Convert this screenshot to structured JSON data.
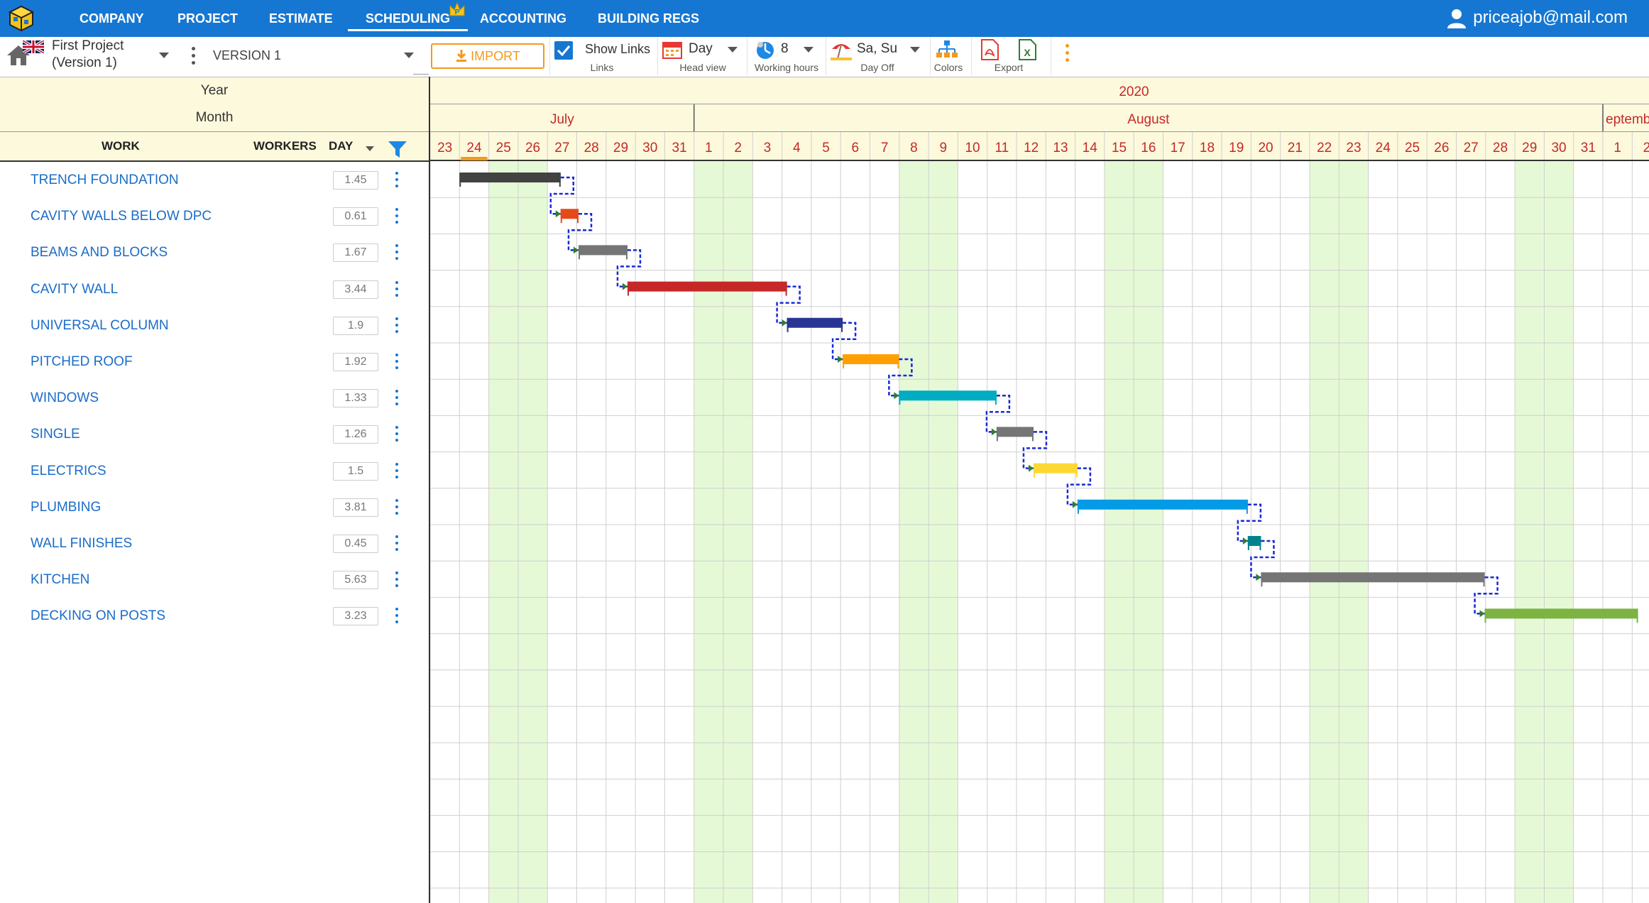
{
  "nav": {
    "items": [
      "COMPANY",
      "PROJECT",
      "ESTIMATE",
      "SCHEDULING",
      "ACCOUNTING",
      "BUILDING REGS"
    ],
    "active": "SCHEDULING",
    "crown_badge": "P",
    "user_email": "priceajob@mail.com"
  },
  "toolbar": {
    "project_name": "First Project",
    "project_version": "(Version 1)",
    "version_select": "VERSION 1",
    "import_label": "IMPORT",
    "show_links_label": "Show Links",
    "show_links_checked": true,
    "links_caption": "Links",
    "head_view_value": "Day",
    "head_view_caption": "Head view",
    "working_hours_value": "8",
    "working_hours_caption": "Working hours",
    "day_off_value": "Sa, Su",
    "day_off_caption": "Day Off",
    "colors_caption": "Colors",
    "export_caption": "Export"
  },
  "grid_header": {
    "year_label": "Year",
    "month_label": "Month",
    "work_col": "WORK",
    "workers_col": "WORKERS",
    "day_col": "DAY",
    "year_value": "2020",
    "months": [
      {
        "label": "July",
        "first_day": "23",
        "last_day": "31"
      },
      {
        "label": "August",
        "first_day": "1",
        "last_day": "31"
      },
      {
        "label": "eptemb",
        "first_day": "1",
        "last_day": "2"
      }
    ],
    "days": [
      "23",
      "24",
      "25",
      "26",
      "27",
      "28",
      "29",
      "30",
      "31",
      "1",
      "2",
      "3",
      "4",
      "5",
      "6",
      "7",
      "8",
      "9",
      "10",
      "11",
      "12",
      "13",
      "14",
      "15",
      "16",
      "17",
      "18",
      "19",
      "20",
      "21",
      "22",
      "23",
      "24",
      "25",
      "26",
      "27",
      "28",
      "29",
      "30",
      "31",
      "1",
      "2"
    ],
    "weekend_day_indices": [
      2,
      3,
      9,
      10,
      16,
      17,
      23,
      24,
      30,
      31,
      37,
      38
    ],
    "today_marker_day_index": 1
  },
  "tasks": [
    {
      "name": "TRENCH FOUNDATION",
      "days": "1.45",
      "color": "#424242",
      "start_day_index": 1.0,
      "duration_days": 3.45
    },
    {
      "name": "CAVITY WALLS BELOW DPC",
      "days": "0.61",
      "color": "#e64a19",
      "start_day_index": 4.45,
      "duration_days": 0.61
    },
    {
      "name": "BEAMS AND BLOCKS",
      "days": "1.67",
      "color": "#757575",
      "start_day_index": 5.06,
      "duration_days": 1.67
    },
    {
      "name": "CAVITY WALL",
      "days": "3.44",
      "color": "#c62828",
      "start_day_index": 6.73,
      "duration_days": 5.44
    },
    {
      "name": "UNIVERSAL COLUMN",
      "days": "1.9",
      "color": "#283593",
      "start_day_index": 12.17,
      "duration_days": 1.9
    },
    {
      "name": "PITCHED ROOF",
      "days": "1.92",
      "color": "#ffa000",
      "start_day_index": 14.07,
      "duration_days": 1.92
    },
    {
      "name": "WINDOWS",
      "days": "1.33",
      "color": "#00acc1",
      "start_day_index": 15.99,
      "duration_days": 3.33
    },
    {
      "name": "SINGLE",
      "days": "1.26",
      "color": "#757575",
      "start_day_index": 19.32,
      "duration_days": 1.26
    },
    {
      "name": "ELECTRICS",
      "days": "1.5",
      "color": "#fdd835",
      "start_day_index": 20.58,
      "duration_days": 1.5
    },
    {
      "name": "PLUMBING",
      "days": "3.81",
      "color": "#039be5",
      "start_day_index": 22.08,
      "duration_days": 5.81
    },
    {
      "name": "WALL FINISHES",
      "days": "0.45",
      "color": "#00838f",
      "start_day_index": 27.89,
      "duration_days": 0.45
    },
    {
      "name": "KITCHEN",
      "days": "5.63",
      "color": "#757575",
      "start_day_index": 28.34,
      "duration_days": 7.63
    },
    {
      "name": "DECKING ON POSTS",
      "days": "3.23",
      "color": "#7cb342",
      "start_day_index": 35.97,
      "duration_days": 5.23
    }
  ]
}
